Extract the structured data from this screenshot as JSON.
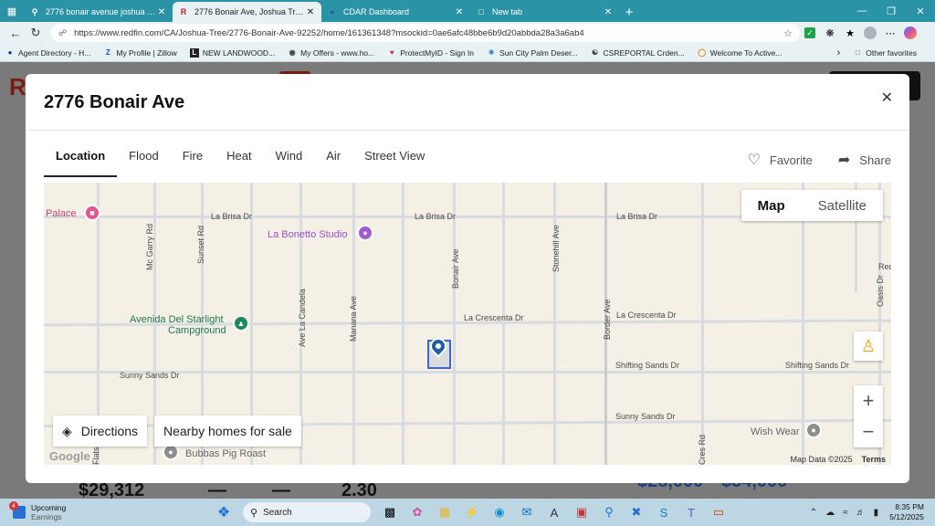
{
  "browser": {
    "tabs": [
      {
        "title": "2776 bonair avenue joshua tree c",
        "active": false,
        "fav": "Q"
      },
      {
        "title": "2776 Bonair Ave, Joshua Tree, CA",
        "active": true,
        "fav": "R"
      },
      {
        "title": "CDAR Dashboard",
        "active": false,
        "fav": "●"
      },
      {
        "title": "New tab",
        "active": false,
        "fav": "□"
      }
    ],
    "url": "https://www.redfin.com/CA/Joshua-Tree/2776-Bonair-Ave-92252/home/161361348?msockid=0ae6afc48bbe6b9d20abbda28a3a6ab4",
    "bookmarks": [
      {
        "label": "Agent Directory - H...",
        "icon": "person-icon"
      },
      {
        "label": "My Profile | Zillow",
        "icon": "zillow-icon"
      },
      {
        "label": "NEW LANDWOOD...",
        "icon": "landwood-icon"
      },
      {
        "label": "My Offers - www.ho...",
        "icon": "offers-icon"
      },
      {
        "label": "ProtectMyID - Sign In",
        "icon": "protect-icon"
      },
      {
        "label": "Sun City Palm Deser...",
        "icon": "suncity-icon"
      },
      {
        "label": "CSREPORTAL Crden...",
        "icon": "globe-icon"
      },
      {
        "label": "Welcome To Active...",
        "icon": "active-icon"
      }
    ],
    "other_favorites": "Other favorites"
  },
  "background_page": {
    "prices": [
      "$29,312",
      "—",
      "—",
      "2.30",
      "$28,000",
      "$34,000"
    ]
  },
  "modal": {
    "title": "2776 Bonair Ave",
    "tabs": [
      "Location",
      "Flood",
      "Fire",
      "Heat",
      "Wind",
      "Air",
      "Street View"
    ],
    "active_tab": "Location",
    "favorite_label": "Favorite",
    "share_label": "Share"
  },
  "map": {
    "map_label": "Map",
    "satellite_label": "Satellite",
    "directions_label": "Directions",
    "nearby_label": "Nearby homes for sale",
    "attribution": "Map Data ©2025",
    "terms": "Terms",
    "google": "Google",
    "roads": {
      "la_brisa_1": "La Brisa Dr",
      "la_brisa_2": "La Brisa Dr",
      "la_brisa_3": "La Brisa Dr",
      "la_crescenta_1": "La Crescenta Dr",
      "la_crescenta_2": "La Crescenta Dr",
      "shifting_1": "Shifting Sands Dr",
      "shifting_2": "Shifting Sands Dr",
      "sunny_1": "Sunny Sands Dr",
      "sunny_2": "Sunny Sands Dr",
      "mc_garry": "Mc Garry Rd",
      "sunset": "Sunset Rd",
      "ave_la_candela": "Ave La Candela",
      "manana": "Manana Ave",
      "bonair": "Bonair Ave",
      "stonehill": "Stonehill Ave",
      "border": "Border Ave",
      "oasis": "Oasis Dr",
      "rec": "Rec",
      "flats": "Flats",
      "cres": "Cres Rd"
    },
    "pois": {
      "palace": "Palace",
      "studio": "La Bonetto Studio",
      "campground_1": "Avenida Del Starlight",
      "campground_2": "Campground",
      "bubbas": "Bubbas Pig Roast",
      "wish_wear": "Wish Wear"
    }
  },
  "taskbar": {
    "weather_title": "Upcoming",
    "weather_sub": "Earnings",
    "badge": "4",
    "search": "Search",
    "time": "8:35 PM",
    "date": "5/12/2025"
  }
}
